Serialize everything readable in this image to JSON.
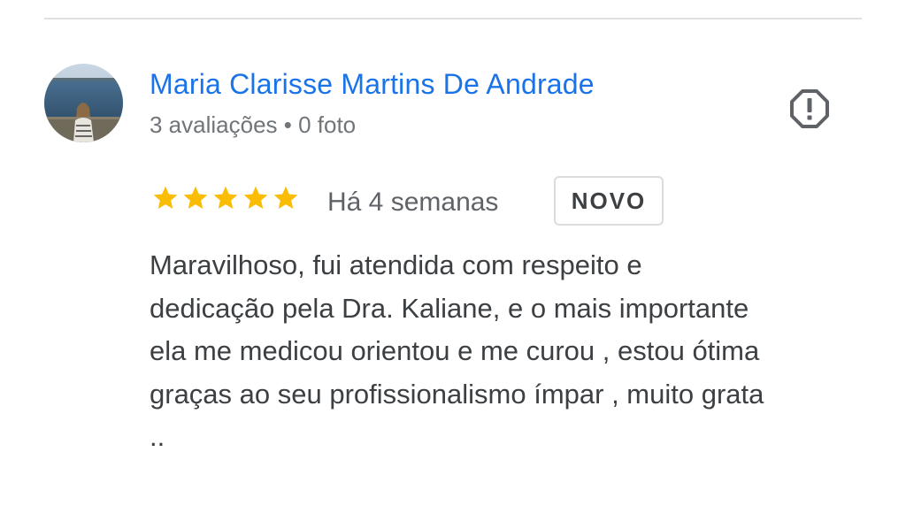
{
  "review": {
    "author_name": "Maria Clarisse Martins De Andrade",
    "author_meta": "3 avaliações • 0 foto",
    "rating": 5,
    "rating_max": 5,
    "date": "Há 4 semanas",
    "badge": "NOVO",
    "text_lines": [
      "Maravilhoso, fui atendida com respeito e",
      "dedicação pela Dra. Kaliane, e o mais importante",
      "ela me medicou orientou e me curou , estou ótima",
      "graças ao seu profissionalismo ímpar , muito grata",
      ".."
    ]
  },
  "icons": {
    "report": "report-flag-icon",
    "star": "star-icon",
    "avatar": "user-avatar-photo"
  },
  "colors": {
    "author_link": "#1a73e8",
    "star": "#fbbc04",
    "meta_text": "#70757a",
    "body_text": "#3c4043",
    "divider": "#e0e0e0"
  }
}
